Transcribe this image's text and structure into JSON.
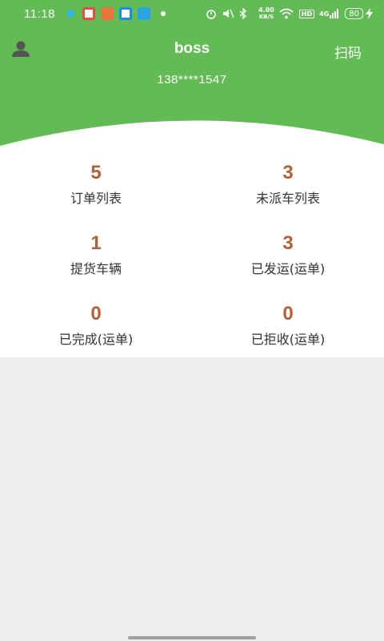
{
  "status_bar": {
    "time": "11:18",
    "net_speed_value": "4.00",
    "net_speed_unit": "KB/S",
    "hd": "HD",
    "signal": "4G",
    "battery": "80"
  },
  "header": {
    "title": "boss",
    "scan_label": "扫码",
    "phone": "138****1547"
  },
  "stats": [
    {
      "value": "5",
      "label": "订单列表"
    },
    {
      "value": "3",
      "label": "未派车列表"
    },
    {
      "value": "1",
      "label": "提货车辆"
    },
    {
      "value": "3",
      "label": "已发运(运单)"
    },
    {
      "value": "0",
      "label": "已完成(运单)"
    },
    {
      "value": "0",
      "label": "已拒收(运单)"
    }
  ],
  "colors": {
    "header_green": "#63bb55",
    "stat_number": "#b65f36",
    "page_background": "#ededed"
  }
}
